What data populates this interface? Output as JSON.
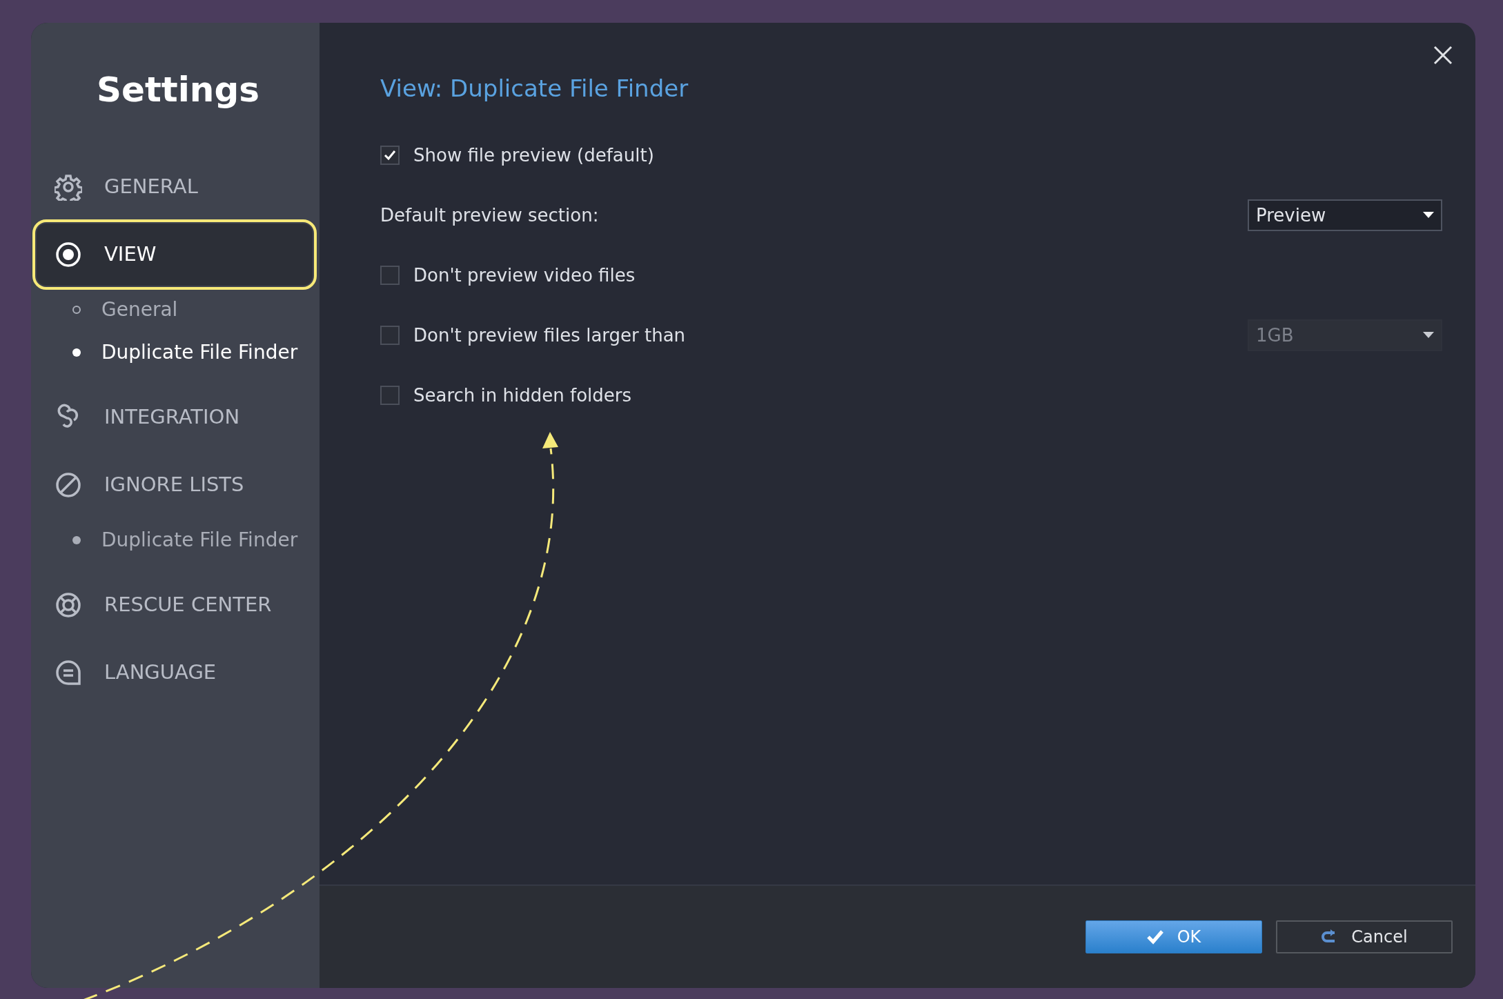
{
  "sidebar": {
    "title": "Settings",
    "items": [
      {
        "label": "GENERAL",
        "selected": false,
        "highlighted": false
      },
      {
        "label": "VIEW",
        "selected": true,
        "highlighted": true,
        "children": [
          {
            "label": "General",
            "kind": "ring",
            "selected": false
          },
          {
            "label": "Duplicate File Finder",
            "kind": "dot",
            "selected": true
          }
        ]
      },
      {
        "label": "INTEGRATION",
        "selected": false,
        "highlighted": false
      },
      {
        "label": "IGNORE LISTS",
        "selected": false,
        "highlighted": false,
        "children": [
          {
            "label": "Duplicate File Finder",
            "kind": "dot",
            "selected": false
          }
        ]
      },
      {
        "label": "RESCUE CENTER",
        "selected": false,
        "highlighted": false
      },
      {
        "label": "LANGUAGE",
        "selected": false,
        "highlighted": false
      }
    ]
  },
  "content": {
    "title": "View: Duplicate File Finder",
    "options": [
      {
        "kind": "checkbox",
        "label": "Show file preview (default)",
        "checked": true
      },
      {
        "kind": "label",
        "label": "Default preview section:",
        "dropdown": {
          "value": "Preview",
          "disabled": false
        }
      },
      {
        "kind": "checkbox",
        "label": "Don't preview video files",
        "checked": false
      },
      {
        "kind": "checkbox",
        "label": "Don't preview files larger than",
        "checked": false,
        "dropdown": {
          "value": "1GB",
          "disabled": true
        }
      },
      {
        "kind": "checkbox",
        "label": "Search in hidden folders",
        "checked": false
      }
    ]
  },
  "buttons": [
    {
      "label": "OK",
      "kind": "primary"
    },
    {
      "label": "Cancel",
      "kind": "secondary"
    }
  ]
}
